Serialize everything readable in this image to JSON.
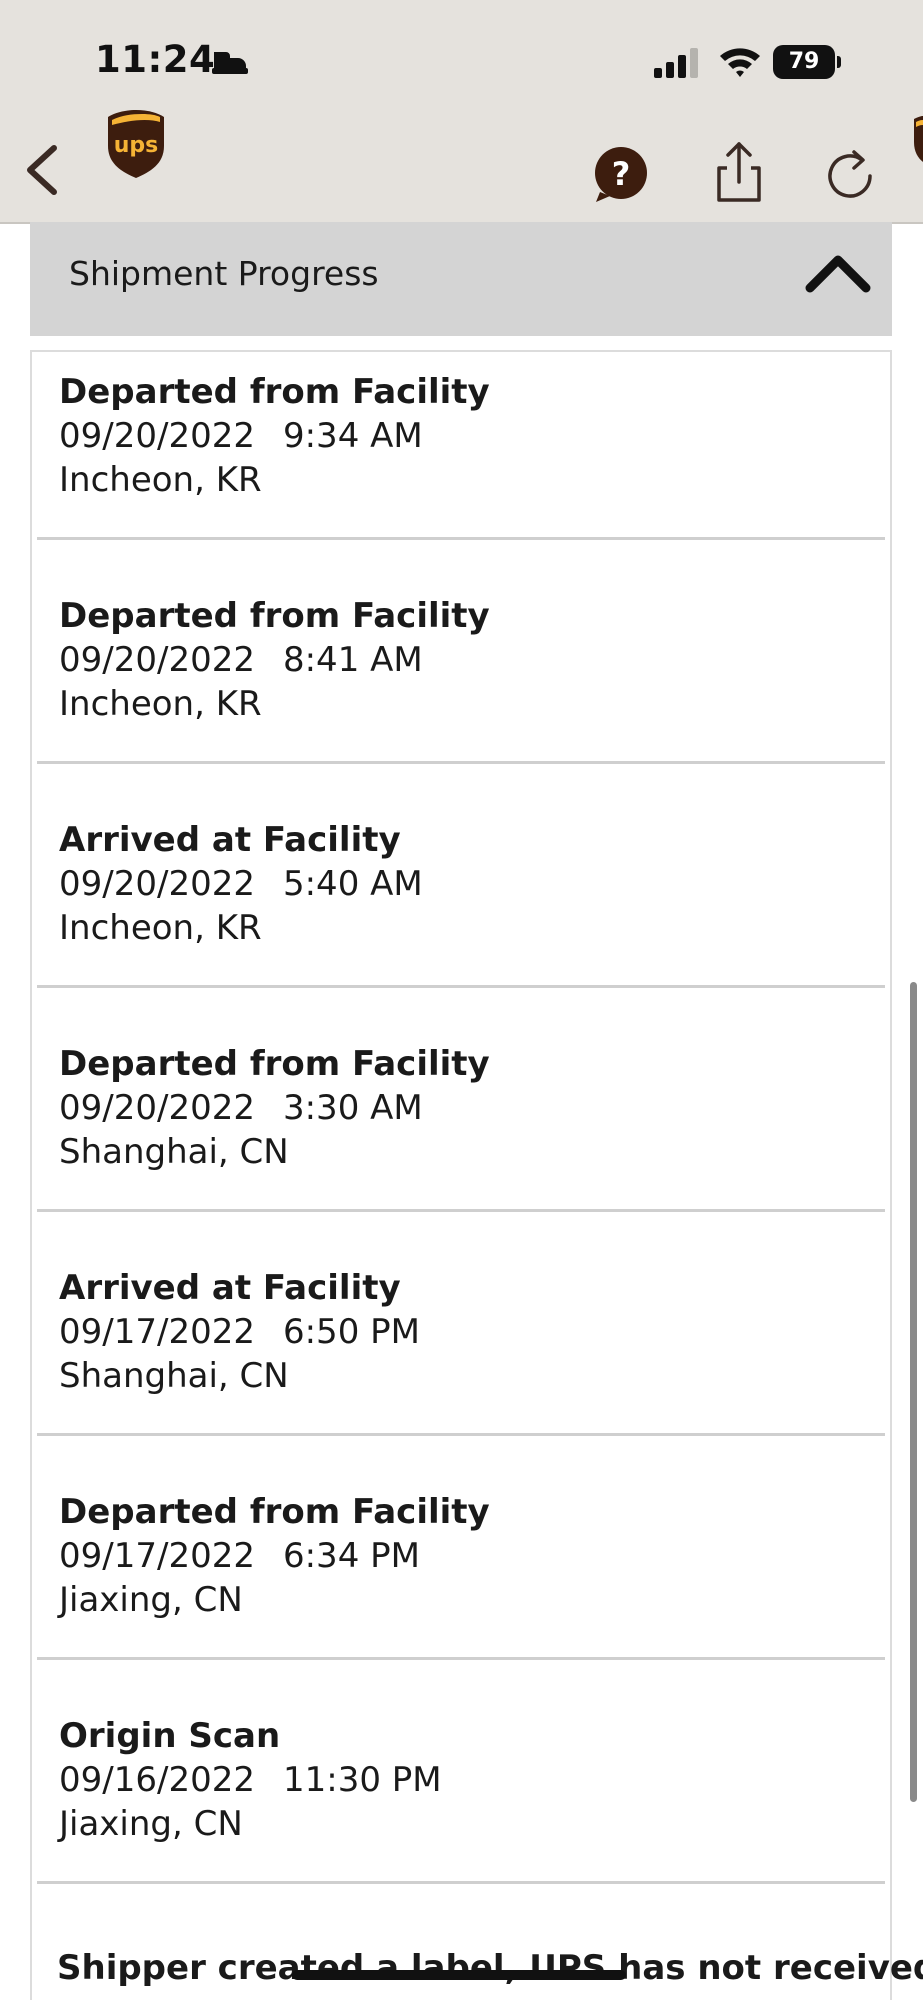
{
  "status_bar": {
    "time": "11:24",
    "battery": "79"
  },
  "nav": {
    "logo_text": "ups"
  },
  "section": {
    "title": "Shipment Progress"
  },
  "events": [
    {
      "status": "Departed from Facility",
      "date": "09/20/2022",
      "time": "9:34 AM",
      "location": "Incheon, KR"
    },
    {
      "status": "Departed from Facility",
      "date": "09/20/2022",
      "time": "8:41 AM",
      "location": "Incheon, KR"
    },
    {
      "status": "Arrived at Facility",
      "date": "09/20/2022",
      "time": "5:40 AM",
      "location": "Incheon, KR"
    },
    {
      "status": "Departed from Facility",
      "date": "09/20/2022",
      "time": "3:30 AM",
      "location": "Shanghai, CN"
    },
    {
      "status": "Arrived at Facility",
      "date": "09/17/2022",
      "time": "6:50 PM",
      "location": "Shanghai, CN"
    },
    {
      "status": "Departed from Facility",
      "date": "09/17/2022",
      "time": "6:34 PM",
      "location": "Jiaxing, CN"
    },
    {
      "status": "Origin Scan",
      "date": "09/16/2022",
      "time": "11:30 PM",
      "location": "Jiaxing, CN"
    }
  ],
  "last_event": {
    "status_partial": "Shipper created a label, UPS has not received"
  },
  "colors": {
    "ups_brown": "#3d1d0e",
    "ups_gold": "#f5b335",
    "chrome_bg": "#e5e2dd",
    "section_bg": "#d4d4d4"
  },
  "icons": {
    "back": "chevron-left-icon",
    "help": "question-bubble-icon",
    "share": "share-icon",
    "refresh": "refresh-icon",
    "collapse": "chevron-up-icon"
  }
}
